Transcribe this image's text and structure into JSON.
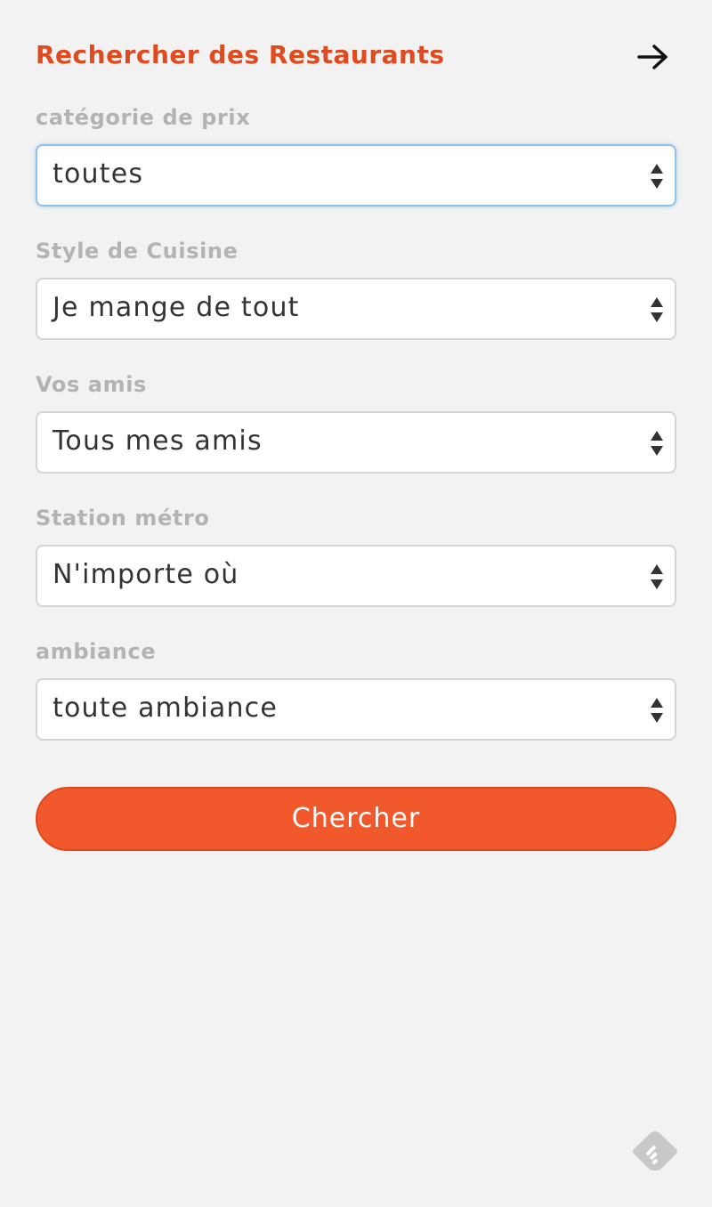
{
  "header": {
    "title": "Rechercher des Restaurants",
    "title_color": "#e04a1f",
    "next_icon": "arrow-right-icon"
  },
  "filters": [
    {
      "label": "catégorie de prix",
      "value": "toutes",
      "focused": true
    },
    {
      "label": "Style de Cuisine",
      "value": "Je mange de tout",
      "focused": false
    },
    {
      "label": "Vos amis",
      "value": "Tous mes amis",
      "focused": false
    },
    {
      "label": "Station métro",
      "value": "N'importe où",
      "focused": false
    },
    {
      "label": "ambiance",
      "value": "toute ambiance",
      "focused": false
    }
  ],
  "search_button": {
    "label": "Chercher",
    "color": "#f1582c"
  },
  "footer": {
    "icon": "feedly-icon"
  },
  "colors": {
    "background": "#f2f2f2",
    "label_gray": "#b3b3b3",
    "focus_border": "#8fc1ec"
  }
}
